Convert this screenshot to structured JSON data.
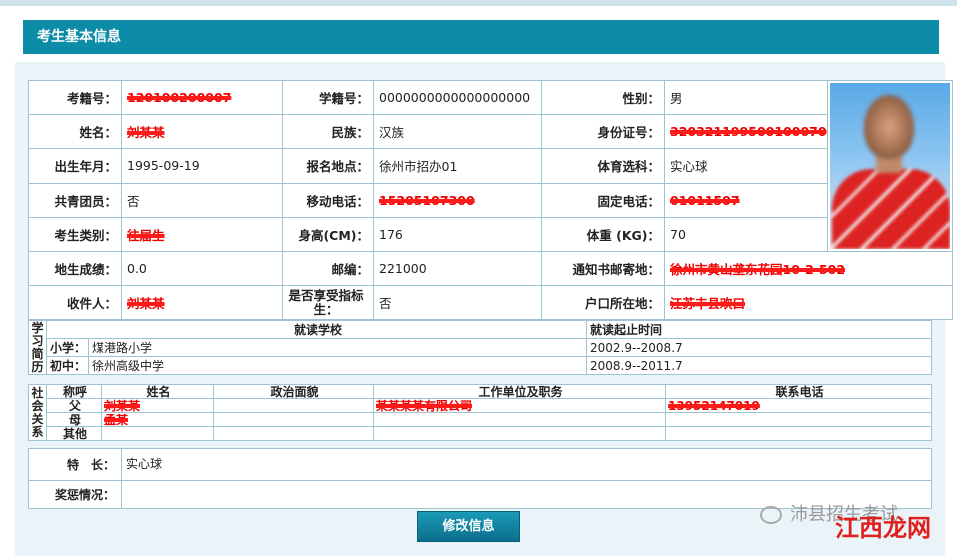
{
  "header": {
    "title": "考生基本信息"
  },
  "info": {
    "exam_no_label": "考籍号：",
    "exam_no": "120100200007",
    "student_no_label": "学籍号：",
    "student_no": "0000000000000000000",
    "gender_label": "性别：",
    "gender": "男",
    "name_label": "姓名：",
    "name": "刘某某",
    "ethnicity_label": "民族：",
    "ethnicity": "汉族",
    "id_label": "身份证号：",
    "id": "320321199500100070",
    "birth_label": "出生年月：",
    "birth": "1995-09-19",
    "reg_place_label": "报名地点：",
    "reg_place": "徐州市招办01",
    "pe_label": "体育选科：",
    "pe": "实心球",
    "league_label": "共青团员：",
    "league": "否",
    "mobile_label": "移动电话：",
    "mobile": "15205107300",
    "phone_label": "固定电话：",
    "phone": "01011507",
    "category_label": "考生类别：",
    "category": "往届生",
    "height_label": "身高(CM)：",
    "height": "176",
    "weight_label": "体重 (KG)：",
    "weight": "70",
    "geo_label": "地生成绩：",
    "geo": "0.0",
    "zip_label": "邮编：",
    "zip": "221000",
    "mail_addr_label": "通知书邮寄地：",
    "mail_addr": "徐州市黄山垄东花园10-2-502",
    "receiver_label": "收件人：",
    "receiver": "刘某某",
    "quota_label": "是否享受指标生：",
    "quota": "否",
    "hukou_label": "户口所在地：",
    "hukou": "江苏丰县欢口"
  },
  "study": {
    "side_label": "学习简历",
    "col_school": "就读学校",
    "col_period": "就读起止时间",
    "rows": [
      {
        "level": "小学：",
        "school": "煤港路小学",
        "period": "2002.9--2008.7"
      },
      {
        "level": "初中：",
        "school": "徐州高级中学",
        "period": "2008.9--2011.7"
      }
    ]
  },
  "family": {
    "side_label": "社会关系",
    "headers": [
      "称呼",
      "姓名",
      "政治面貌",
      "工作单位及职务",
      "联系电话"
    ],
    "rows": [
      {
        "relation": "父",
        "name": "刘某某",
        "political": "",
        "work": "某某某某有限公司",
        "tel": "13952147019"
      },
      {
        "relation": "母",
        "name": "孟某",
        "political": "",
        "work": "",
        "tel": ""
      },
      {
        "relation": "其他",
        "name": "",
        "political": "",
        "work": "",
        "tel": ""
      }
    ]
  },
  "extra": {
    "skill_label": "特　长：",
    "skill": "实心球",
    "award_label": "奖惩情况：",
    "award": ""
  },
  "actions": {
    "edit_label": "修改信息"
  },
  "watermark": {
    "text": "沛县招生考试",
    "brand": "江西龙网"
  }
}
